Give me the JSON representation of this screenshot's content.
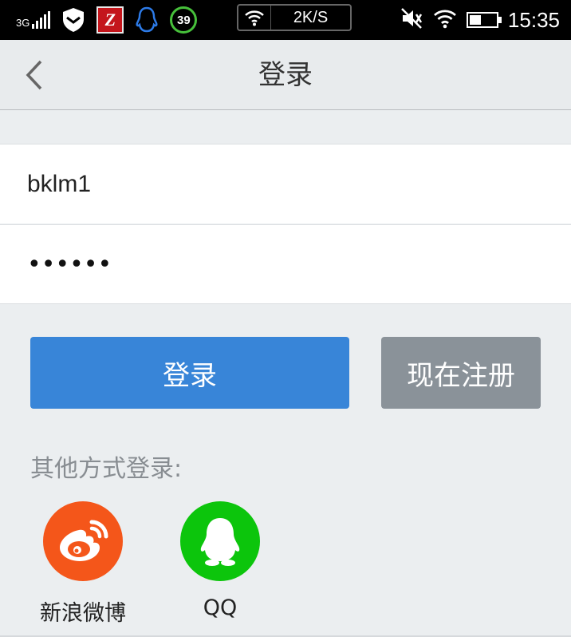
{
  "status_bar": {
    "network_type": "3G",
    "notification_icons": [
      "shield-icon",
      "z-app-icon",
      "qq-penguin-icon",
      "badge-39-icon"
    ],
    "badge_number": "39",
    "z_letter": "Z",
    "net_speed": "2K/S",
    "right_icons": [
      "mute-icon",
      "wifi-icon",
      "battery-icon"
    ],
    "time": "15:35"
  },
  "header": {
    "back_icon": "chevron-left-icon",
    "title": "登录"
  },
  "form": {
    "username_value": "bklm1",
    "password_masked": "••••••"
  },
  "actions": {
    "login_label": "登录",
    "register_label": "现在注册"
  },
  "other_login": {
    "label": "其他方式登录:",
    "providers": [
      {
        "label": "新浪微博",
        "icon": "weibo-icon",
        "color": "#f4561a"
      },
      {
        "label": "QQ",
        "icon": "qq-icon",
        "color": "#0cc50c"
      }
    ]
  },
  "colors": {
    "primary": "#3885d8",
    "secondary": "#8a9299",
    "background": "#ebeef0"
  }
}
